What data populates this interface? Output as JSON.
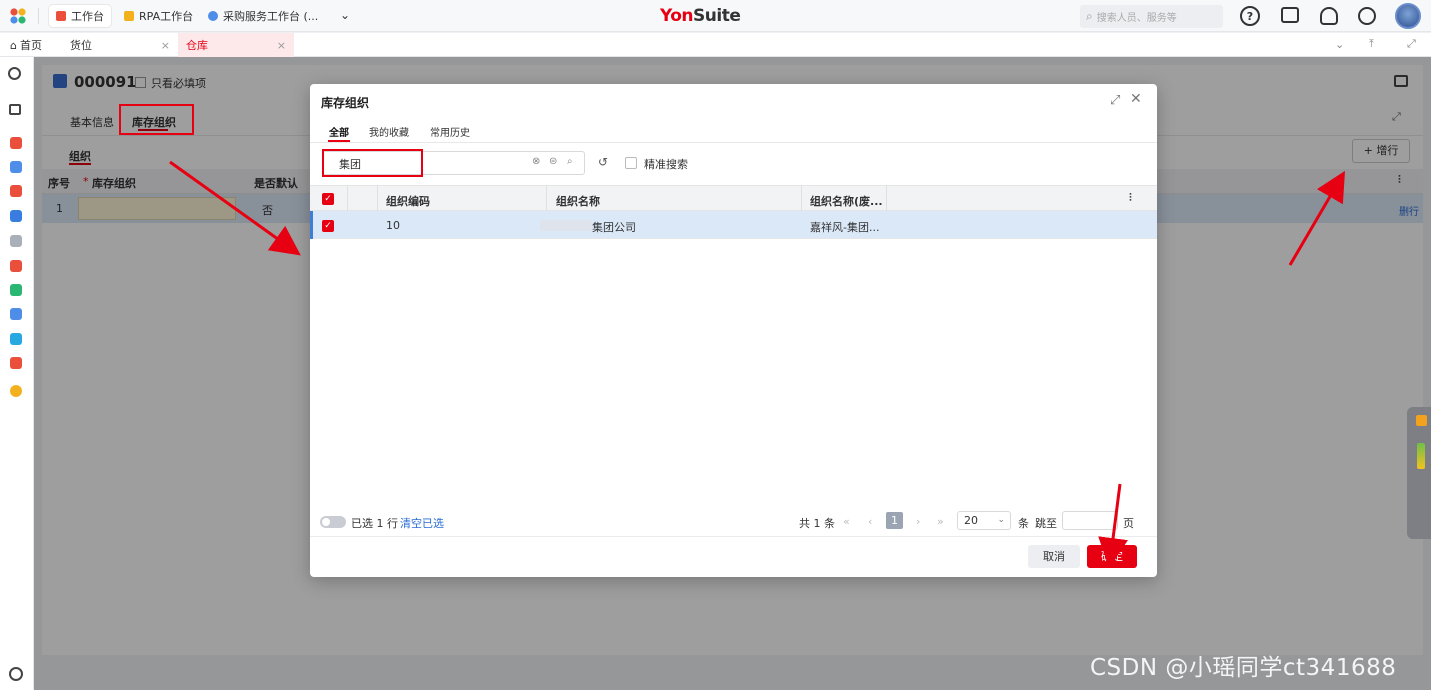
{
  "topbar": {
    "tabs": [
      {
        "label": "工作台",
        "icon": "workbench-icon",
        "color": "#e94f3a"
      },
      {
        "label": "RPA工作台",
        "icon": "rpa-icon",
        "color": "#f3b21d"
      },
      {
        "label": "采购服务工作台 (...",
        "icon": "purchase-icon",
        "color": "#4e8ee8"
      }
    ],
    "brand_y": "Yon",
    "brand_s": "Suite",
    "search_placeholder": "搜索人员、服务等",
    "help_icon": "?"
  },
  "page_tabs": [
    {
      "label": "首页",
      "icon": "home-icon"
    },
    {
      "label": "货位",
      "close": "×"
    },
    {
      "label": "仓库",
      "close": "×",
      "active": true
    }
  ],
  "background_page": {
    "doc_code": "000091",
    "required_only": "只看必填项",
    "tabs": [
      "基本信息",
      "库存组织"
    ],
    "section": "组织",
    "columns": [
      "序号",
      "库存组织",
      "是否默认"
    ],
    "row": {
      "index": "1",
      "default": "否"
    },
    "add_row": "+ 增行",
    "delete_row": "删行",
    "required_mark": "*"
  },
  "modal": {
    "title": "库存组织",
    "tabs": [
      "全部",
      "我的收藏",
      "常用历史"
    ],
    "search_value": "集团",
    "exact_search": "精准搜索",
    "columns": [
      "组织编码",
      "组织名称",
      "组织名称(废..."
    ],
    "rows": [
      {
        "code": "10",
        "name": "集团公司",
        "name_old": "嘉祥风-集团..."
      }
    ],
    "selected_text": "已选 1 行",
    "clear_selected": "清空已选",
    "total": "共 1 条",
    "current_page": "1",
    "page_size": "20",
    "unit_per_page": "条",
    "jump_to": "跳至",
    "page_unit": "页",
    "cancel": "取消",
    "confirm": "确定"
  },
  "watermark": "CSDN @小瑶同学ct341688",
  "colors": {
    "accent": "#e60012",
    "selected_row": "#dbe8f8",
    "link": "#2a6cd6"
  }
}
